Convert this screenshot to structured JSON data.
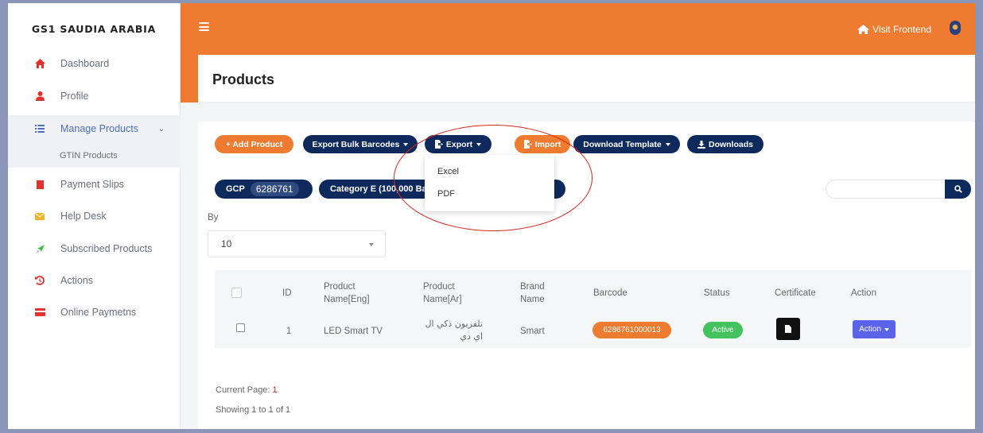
{
  "sidebar": {
    "brand": "GS1 SAUDIA ARABIA",
    "items": [
      {
        "label": "Dashboard",
        "icon": "home-icon",
        "color": "#e2322b"
      },
      {
        "label": "Profile",
        "icon": "user-icon",
        "color": "#e2322b"
      },
      {
        "label": "Manage Products",
        "icon": "list-icon",
        "color": "#4a6fb8"
      },
      {
        "label": "Payment Slips",
        "icon": "document-icon",
        "color": "#e2322b"
      },
      {
        "label": "Help Desk",
        "icon": "envelope-icon",
        "color": "#f0b429"
      },
      {
        "label": "Subscribed Products",
        "icon": "rocket-icon",
        "color": "#3fbf3f"
      },
      {
        "label": "Actions",
        "icon": "history-icon",
        "color": "#e2322b"
      },
      {
        "label": "Online Paymetns",
        "icon": "credit-card-icon",
        "color": "#e2322b"
      }
    ],
    "sub_item": "GTIN Products"
  },
  "topbar": {
    "visit_label": "Visit Frontend",
    "accent": "#ee7b30"
  },
  "page": {
    "title": "Products"
  },
  "toolbar": {
    "add_product": "+ Add Product",
    "export_bulk": "Export Bulk Barcodes",
    "export": "Export",
    "import": "Import",
    "download_template": "Download Template",
    "downloads": "Downloads"
  },
  "export_menu": [
    "Excel",
    "PDF"
  ],
  "filters": {
    "gcp_label": "GCP",
    "gcp_value": "6286761",
    "category": "Category E (100,000 Ba",
    "by_label": "By",
    "per_page": "10"
  },
  "table": {
    "headers": {
      "id": "ID",
      "name_eng": [
        "Product",
        "Name[Eng]"
      ],
      "name_ar": [
        "Product",
        "Name[Ar]"
      ],
      "brand": [
        "Brand",
        "Name"
      ],
      "barcode": "Barcode",
      "status": "Status",
      "certificate": "Certificate",
      "action": "Action"
    },
    "rows": [
      {
        "id": "1",
        "name_eng": "LED Smart TV",
        "name_ar": [
          "تلفزيون ذكي ال",
          "اي دي"
        ],
        "brand": "Smart",
        "barcode": "6286761000013",
        "status": "Active",
        "action": "Action"
      }
    ]
  },
  "pagination": {
    "current_label": "Current Page:",
    "current_value": "1",
    "showing": "Showing 1 to 1 of 1"
  }
}
